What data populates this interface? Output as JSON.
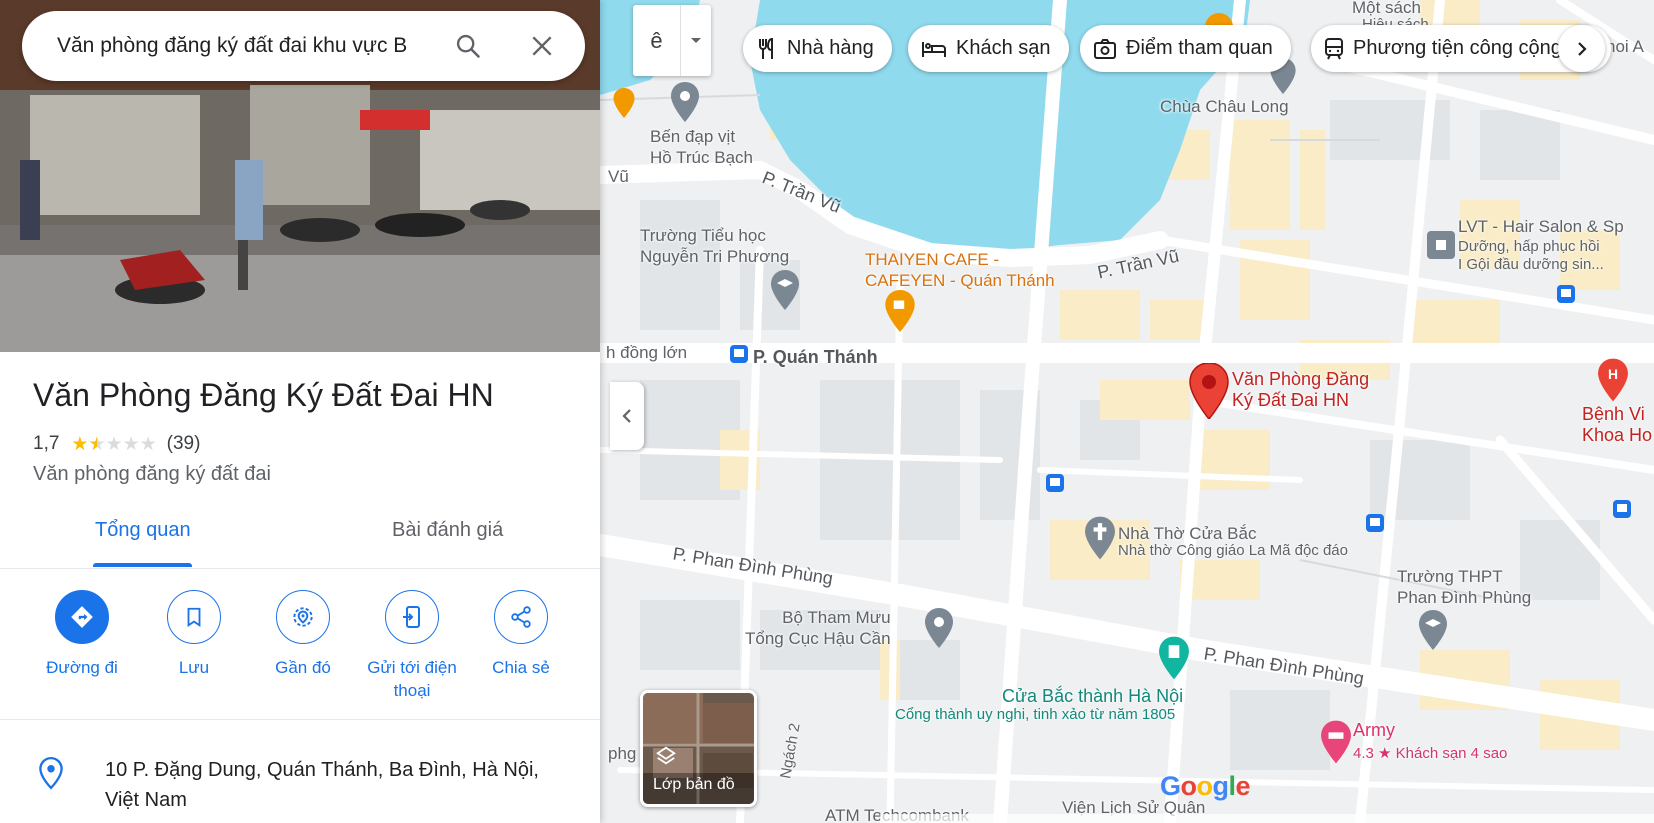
{
  "search": {
    "value": "Văn phòng đăng ký đất đai khu vực B"
  },
  "place": {
    "title": "Văn Phòng Đăng Ký Đất Đai HN",
    "rating": "1,7",
    "rating_value": 1.7,
    "review_count": "(39)",
    "category": "Văn phòng đăng ký đất đai"
  },
  "tabs": [
    {
      "label": "Tổng quan"
    },
    {
      "label": "Bài đánh giá"
    }
  ],
  "actions": [
    {
      "label": "Đường đi",
      "icon": "directions-icon"
    },
    {
      "label": "Lưu",
      "icon": "bookmark-icon"
    },
    {
      "label": "Gần đó",
      "icon": "nearby-icon"
    },
    {
      "label": "Gửi tới điện thoại",
      "icon": "send-to-phone-icon"
    },
    {
      "label": "Chia sẻ",
      "icon": "share-icon"
    }
  ],
  "address": {
    "line": "10 P. Đặng Dung, Quán Thánh, Ba Đình, Hà Nội, Việt Nam"
  },
  "map_controls": {
    "language_glyph": "ê",
    "chips": [
      {
        "label": "Nhà hàng",
        "icon": "restaurant-icon"
      },
      {
        "label": "Khách sạn",
        "icon": "hotel-icon"
      },
      {
        "label": "Điểm tham quan",
        "icon": "camera-icon"
      },
      {
        "label": "Phương tiện công cộng",
        "icon": "transit-icon"
      }
    ],
    "layers_label": "Lớp bản đồ",
    "logo": "Google"
  },
  "map_labels": {
    "p_tran_vu_1": "P. Trần Vũ",
    "p_tran_vu_2": "P. Trần Vũ",
    "p_quan_thanh": "P. Quán Thánh",
    "p_phan_dinh_phung_1": "P. Phan Đình Phùng",
    "p_phan_dinh_phung_2": "P. Phan Đình Phùng",
    "vu": "Vũ",
    "dong_lon": "h đồng lớn",
    "ben_dap_vit": "Bến đạp vịt\nHồ Trúc Bạch",
    "truong_tieu_hoc": "Trường Tiểu học\nNguyễn Tri Phương",
    "thaiyen_cafe": "THAIYEN CAFE -\nCAFEYEN - Quán Thánh",
    "chua_chau_long": "Chùa Châu Long",
    "mot_sach": "Một sách",
    "hieu_sach": "Hiệu sách",
    "lvt_salon": "LVT - Hair Salon & Sp",
    "lvt_desc": "Dưỡng, hấp phục hồi\nI Gội đầu dưỡng sin...",
    "noi_a": "hoi A",
    "target_pin": "Văn Phòng Đăng\nKý Đất Đai HN",
    "benh_vien": "Bệnh Vi\nKhoa Ho",
    "nha_tho": "Nhà Thờ Cửa Bắc",
    "nha_tho_desc": "Nhà thờ Công giáo La Mã độc đáo",
    "truong_thpt": "Trường THPT\nPhan Đình Phùng",
    "bo_tham_muu": "Bộ Tham Mưu\nTổng Cục Hậu Cần",
    "cua_bac": "Cửa Bắc thành Hà Nội",
    "cua_bac_desc": "Cổng thành uy nghi, tinh xảo từ năm 1805",
    "army": "Army",
    "army_desc": "4.3 ★ Khách sạn 4 sao",
    "ngach_2": "Ngách 2",
    "phg": "phg",
    "atm": "ATM Techcombank",
    "vien_lich_su": "Viện Lịch Sử Quân"
  },
  "colors": {
    "accent": "#1a73e8",
    "water": "#90daee",
    "pin": "#ea4335",
    "star": "#fbbc04"
  }
}
